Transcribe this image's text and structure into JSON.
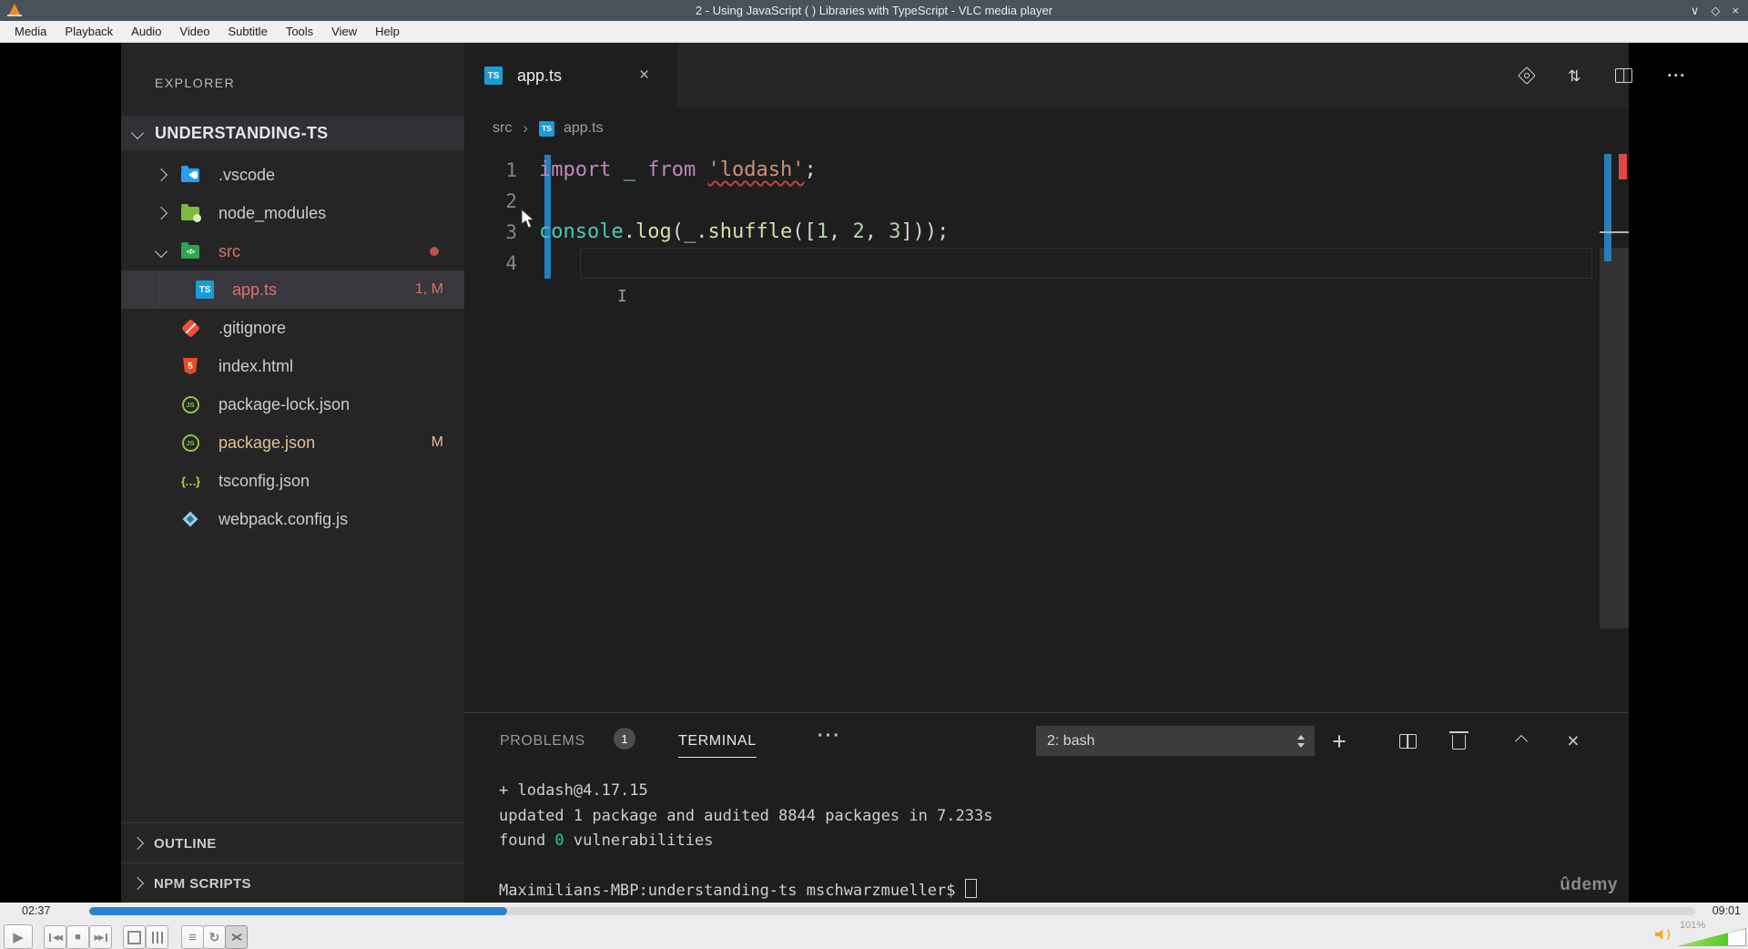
{
  "window": {
    "title": "2 - Using JavaScript ( ) Libraries with TypeScript - VLC media player",
    "controls": {
      "minimize": "∨",
      "maximize": "◇",
      "close": "×"
    }
  },
  "menu_bar": {
    "items": [
      "Media",
      "Playback",
      "Audio",
      "Video",
      "Subtitle",
      "Tools",
      "View",
      "Help"
    ]
  },
  "vscode": {
    "explorer": {
      "title": "EXPLORER",
      "project": {
        "name": "UNDERSTANDING-TS"
      },
      "files": [
        {
          "name": ".vscode",
          "icon": "vscode-folder-icon",
          "chevron": "right",
          "level": "root"
        },
        {
          "name": "node_modules",
          "icon": "node-modules-folder-icon",
          "chevron": "right",
          "level": "root"
        },
        {
          "name": "src",
          "icon": "src-folder-icon",
          "chevron": "down",
          "level": "root",
          "color": "#dd7265",
          "dot": true
        },
        {
          "name": "app.ts",
          "icon": "typescript-file-icon",
          "level": "child",
          "color": "#dd7265",
          "badge": "1, M",
          "badge_color": "#dd7265",
          "selected": true,
          "guide": true
        },
        {
          "name": ".gitignore",
          "icon": "git-file-icon",
          "level": "root"
        },
        {
          "name": "index.html",
          "icon": "html-file-icon",
          "level": "root"
        },
        {
          "name": "package-lock.json",
          "icon": "node-json-file-icon",
          "level": "root"
        },
        {
          "name": "package.json",
          "icon": "node-json-file-icon",
          "level": "root",
          "color": "#e2c08d",
          "badge": "M",
          "badge_color": "#e2c08d"
        },
        {
          "name": "tsconfig.json",
          "icon": "tsconfig-file-icon",
          "level": "root"
        },
        {
          "name": "webpack.config.js",
          "icon": "webpack-file-icon",
          "level": "root"
        }
      ],
      "sections": [
        {
          "label": "OUTLINE"
        },
        {
          "label": "NPM SCRIPTS"
        }
      ]
    },
    "editor": {
      "tab": {
        "label": "app.ts",
        "ts_badge": "TS",
        "close_glyph": "×"
      },
      "actions_more_glyph": "···",
      "compare_glyph": "⇄",
      "breadcrumb": {
        "folder": "src",
        "separator": "›",
        "ts_badge": "TS",
        "file": "app.ts"
      },
      "code": [
        {
          "num": "1",
          "tokens": [
            {
              "t": "import",
              "c": "kw"
            },
            {
              "t": " "
            },
            {
              "t": "_",
              "c": "vr"
            },
            {
              "t": " "
            },
            {
              "t": "from",
              "c": "kw"
            },
            {
              "t": " "
            },
            {
              "t": "'lodash'",
              "c": "st",
              "squiggle": true
            },
            {
              "t": ";"
            }
          ]
        },
        {
          "num": "2",
          "tokens": []
        },
        {
          "num": "3",
          "tokens": [
            {
              "t": "console",
              "c": "cl"
            },
            {
              "t": "."
            },
            {
              "t": "log",
              "c": "fn"
            },
            {
              "t": "("
            },
            {
              "t": "_",
              "c": "vr"
            },
            {
              "t": "."
            },
            {
              "t": "shuffle",
              "c": "fn"
            },
            {
              "t": "(["
            },
            {
              "t": "1",
              "c": "nm"
            },
            {
              "t": ", "
            },
            {
              "t": "2",
              "c": "nm"
            },
            {
              "t": ", "
            },
            {
              "t": "3",
              "c": "nm"
            },
            {
              "t": "]));"
            }
          ]
        },
        {
          "num": "4",
          "tokens": [],
          "current": true
        }
      ]
    },
    "panel": {
      "tabs": [
        {
          "label": "PROBLEMS",
          "badge": "1"
        },
        {
          "label": "TERMINAL",
          "active": true
        }
      ],
      "more_glyph": "···",
      "shell_selector": {
        "value": "2: bash"
      },
      "actions": {
        "new_glyph": "+",
        "close_glyph": "×"
      },
      "terminal": [
        [
          {
            "t": "+ lodash@4.17.15"
          }
        ],
        [
          {
            "t": "updated 1 package and audited 8844 packages in 7.233s"
          }
        ],
        [
          {
            "t": "found "
          },
          {
            "t": "0",
            "c": "green"
          },
          {
            "t": " vulnerabilities"
          }
        ],
        [],
        [
          {
            "t": "Maximilians-MBP:understanding-ts mschwarzmueller$ "
          },
          {
            "cursor": true
          }
        ]
      ],
      "watermark": "ûdemy"
    }
  },
  "player": {
    "elapsed": "02:37",
    "total": "09:01",
    "progress_pct": 26,
    "volume_label": "101%",
    "volume_fill_pct": 74,
    "glyphs": {
      "play": "▶",
      "prev": "◀◀",
      "stop": "■",
      "next": "▶▶",
      "playlist": "≡",
      "loop": "↻"
    }
  },
  "colors": {
    "vlc_titlebar": "#47525a",
    "vlc_progress_blue": "#2e7fd0",
    "vlc_volume_green": "#4fcb24",
    "editor_bg": "#1e1e1e",
    "sidebar_bg": "#252526",
    "selected_row": "#37373d",
    "file_error_modified": "#dd7265",
    "file_modified": "#e2c08d",
    "gutter_modified_blue": "#2080c0",
    "overview_error_red": "#e14a42",
    "terminal_green": "#23d18b",
    "token_keyword": "#c586c0",
    "token_variable": "#9cdcfe",
    "token_string": "#ce9178",
    "token_class": "#4ec9b0",
    "token_function": "#dcdcaa",
    "token_number": "#b5cea8"
  }
}
